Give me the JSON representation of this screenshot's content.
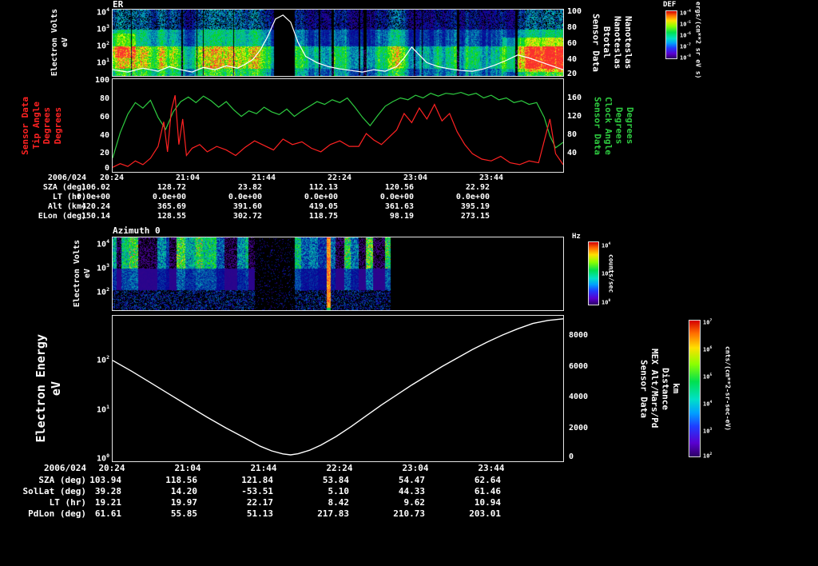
{
  "colors": {
    "background": "#000000",
    "foreground": "#ffffff",
    "tip_angle_red": "#ff2222",
    "clock_angle_green": "#2ecc40",
    "frame": "#e4e4e4"
  },
  "time_axis": {
    "date_label": "2006/024",
    "ticks": [
      "20:24",
      "21:04",
      "21:44",
      "22:24",
      "23:04",
      "23:44"
    ],
    "span_minutes": 238
  },
  "chart_data": [
    {
      "type": "heatmap",
      "title": "ER",
      "ylabel_lines": [
        "Electron Volts",
        "eV"
      ],
      "y_scale": "log",
      "y_ticks": [
        "10^4",
        "10^3",
        "10^2",
        "10^1"
      ],
      "x_ticks": [
        "20:24",
        "21:04",
        "21:44",
        "22:24",
        "23:04",
        "23:44"
      ],
      "gap_minutes": [
        85,
        96
      ],
      "description": "Electron energy flux spectrogram: enhanced green/yellow flux below ~100 eV, purple/blue noise at high energies, black data gap near 21:49-22:00, bright low-energy patch at right end.",
      "colorbar": {
        "title": "DEF",
        "units": "ergs/(cm**2 sr eV s)",
        "ticks": [
          "10^-4",
          "10^-5",
          "10^-6",
          "10^-7",
          "10^-8"
        ]
      },
      "overlay": {
        "name": "Btotal",
        "axis": "right",
        "label_lines": [
          "Sensor Data",
          "Btotal",
          "Nanoteslas",
          "Nanoteslas"
        ],
        "ylim": [
          20,
          100
        ],
        "y_ticks": [
          "100",
          "80",
          "60",
          "40",
          "20"
        ],
        "t_minutes": [
          0,
          8,
          16,
          24,
          30,
          36,
          42,
          48,
          54,
          60,
          66,
          70,
          74,
          78,
          82,
          86,
          90,
          94,
          98,
          102,
          108,
          114,
          120,
          126,
          132,
          138,
          144,
          150,
          154,
          158,
          162,
          166,
          172,
          178,
          184,
          190,
          196,
          202,
          208,
          214,
          220,
          226,
          232,
          238
        ],
        "values_nt": [
          27,
          24,
          29,
          25,
          31,
          27,
          24,
          30,
          27,
          32,
          29,
          34,
          40,
          52,
          70,
          92,
          97,
          88,
          62,
          44,
          36,
          31,
          28,
          26,
          24,
          27,
          25,
          31,
          42,
          56,
          46,
          36,
          31,
          28,
          26,
          25,
          28,
          33,
          39,
          46,
          42,
          37,
          32,
          27
        ]
      }
    },
    {
      "type": "line",
      "x_ticks": [
        "20:24",
        "21:04",
        "21:44",
        "22:24",
        "23:04",
        "23:44"
      ],
      "left_axis": {
        "label_lines": [
          "Sensor Data",
          "Tip Angle",
          "Degrees",
          "Degrees"
        ],
        "color": "#ff2222",
        "ylim": [
          0,
          100
        ],
        "ticks": [
          "100",
          "80",
          "60",
          "40",
          "20",
          "0"
        ]
      },
      "right_axis": {
        "label_lines": [
          "Sensor Data",
          "Clock Angle",
          "Degrees",
          "Degrees"
        ],
        "color": "#2ecc40",
        "ylim": [
          0,
          200
        ],
        "ticks": [
          "160",
          "120",
          "80",
          "40"
        ]
      },
      "series": [
        {
          "name": "Tip Angle",
          "axis": "left",
          "color": "#ff2222",
          "t_minutes": [
            0,
            4,
            8,
            12,
            16,
            20,
            24,
            27,
            29,
            31,
            33,
            35,
            37,
            39,
            42,
            46,
            50,
            55,
            60,
            65,
            70,
            75,
            80,
            85,
            90,
            95,
            100,
            105,
            110,
            115,
            120,
            125,
            130,
            134,
            138,
            142,
            146,
            150,
            154,
            158,
            162,
            166,
            170,
            174,
            178,
            182,
            186,
            190,
            195,
            200,
            205,
            210,
            215,
            220,
            225,
            228,
            231,
            234,
            238
          ],
          "values_deg": [
            5,
            9,
            6,
            12,
            8,
            15,
            28,
            55,
            22,
            68,
            84,
            30,
            58,
            18,
            26,
            30,
            22,
            28,
            24,
            18,
            27,
            34,
            29,
            24,
            36,
            30,
            33,
            26,
            22,
            30,
            34,
            28,
            28,
            42,
            35,
            30,
            38,
            46,
            64,
            54,
            70,
            58,
            74,
            56,
            64,
            44,
            30,
            20,
            14,
            12,
            17,
            10,
            8,
            12,
            10,
            34,
            58,
            20,
            8
          ]
        },
        {
          "name": "Clock Angle",
          "axis": "right",
          "color": "#2ecc40",
          "t_minutes": [
            0,
            4,
            8,
            12,
            16,
            20,
            24,
            28,
            32,
            36,
            40,
            44,
            48,
            52,
            56,
            60,
            64,
            68,
            72,
            76,
            80,
            84,
            88,
            92,
            96,
            100,
            104,
            108,
            112,
            116,
            120,
            124,
            128,
            132,
            136,
            140,
            144,
            148,
            152,
            156,
            160,
            164,
            168,
            172,
            176,
            180,
            184,
            188,
            192,
            196,
            200,
            204,
            208,
            212,
            216,
            220,
            224,
            228,
            231,
            234,
            238
          ],
          "values_deg": [
            30,
            85,
            125,
            150,
            138,
            155,
            118,
            92,
            130,
            152,
            162,
            150,
            164,
            154,
            140,
            152,
            134,
            120,
            132,
            126,
            140,
            130,
            124,
            136,
            120,
            132,
            142,
            152,
            146,
            156,
            150,
            160,
            140,
            118,
            100,
            122,
            142,
            152,
            160,
            156,
            166,
            160,
            170,
            164,
            170,
            168,
            172,
            166,
            170,
            160,
            166,
            156,
            160,
            150,
            154,
            146,
            150,
            118,
            78,
            52,
            64
          ]
        }
      ]
    },
    {
      "type": "heatmap",
      "title": "Azimuth 0",
      "ylabel_lines": [
        "Electron Volts",
        "eV"
      ],
      "y_scale": "log",
      "y_ticks": [
        "10^4",
        "10^3",
        "10^2"
      ],
      "coverage": {
        "data_end_fraction": 0.617,
        "gap_fraction": [
          0.315,
          0.403
        ],
        "bright_stripe_fraction": [
          0.474,
          0.483
        ]
      },
      "description": "Burst-mode electron spectrogram: vertical cyan/green/yellow bursts above ~300 eV, purple speckle below, bright orange full-height stripe near 22:20, no data after ~22:50.",
      "colorbar": {
        "title": "Hz",
        "units": "counts/sec",
        "ticks": [
          "10^4",
          "10^2",
          "10^0"
        ]
      }
    },
    {
      "type": "line",
      "left_axis": {
        "label_lines": [
          "Electron Energy",
          "eV"
        ],
        "scale": "log",
        "ticks": [
          "10^2",
          "10^1",
          "10^0"
        ]
      },
      "right_axis": {
        "label_lines": [
          "Sensor Data",
          "MEX Alt/Mars/Pd",
          "Distance",
          "km"
        ],
        "ylim": [
          0,
          9300
        ],
        "ticks": [
          "8000",
          "6000",
          "4000",
          "2000",
          "0"
        ]
      },
      "colorbar": {
        "units": "cnts/(cm**2-sr-sec-eV)",
        "ticks": [
          "10^7",
          "10^6",
          "10^5",
          "10^4",
          "10^3",
          "10^2"
        ]
      },
      "series": [
        {
          "name": "MEX Alt/Mars/Pd Distance",
          "axis": "right",
          "color": "#ffffff",
          "t_minutes": [
            0,
            10,
            20,
            30,
            40,
            50,
            60,
            70,
            78,
            84,
            90,
            94,
            98,
            104,
            110,
            118,
            126,
            134,
            142,
            150,
            158,
            166,
            174,
            182,
            190,
            198,
            206,
            214,
            222,
            230,
            238
          ],
          "values_km": [
            6400,
            5700,
            4950,
            4200,
            3450,
            2700,
            2000,
            1350,
            820,
            520,
            320,
            260,
            330,
            560,
            900,
            1450,
            2100,
            2800,
            3500,
            4150,
            4800,
            5400,
            6000,
            6550,
            7100,
            7600,
            8050,
            8450,
            8800,
            9000,
            9100
          ]
        }
      ]
    }
  ],
  "annotations_upper": {
    "date": "2006/024",
    "rows": [
      {
        "label": "SZA (deg)",
        "values": [
          "106.02",
          "128.72",
          "23.82",
          "112.13",
          "120.56",
          "22.92"
        ]
      },
      {
        "label": "LT (hr)",
        "values": [
          "0.0e+00",
          "0.0e+00",
          "0.0e+00",
          "0.0e+00",
          "0.0e+00",
          "0.0e+00"
        ]
      },
      {
        "label": "Alt (km)",
        "values": [
          "420.24",
          "365.69",
          "391.60",
          "419.05",
          "361.63",
          "395.19"
        ]
      },
      {
        "label": "ELon (deg)",
        "values": [
          "150.14",
          "128.55",
          "302.72",
          "118.75",
          "98.19",
          "273.15"
        ]
      }
    ]
  },
  "annotations_lower": {
    "date": "2006/024",
    "rows": [
      {
        "label": "SZA (deg)",
        "values": [
          "103.94",
          "118.56",
          "121.84",
          "53.84",
          "54.47",
          "62.64"
        ]
      },
      {
        "label": "SolLat (deg)",
        "values": [
          "39.28",
          "14.20",
          "-53.51",
          "5.10",
          "44.33",
          "61.46"
        ]
      },
      {
        "label": "LT (hr)",
        "values": [
          "19.21",
          "19.97",
          "22.17",
          "8.42",
          "9.62",
          "10.94"
        ]
      },
      {
        "label": "PdLon (deg)",
        "values": [
          "61.61",
          "55.85",
          "51.13",
          "217.83",
          "210.73",
          "203.01"
        ]
      }
    ]
  }
}
